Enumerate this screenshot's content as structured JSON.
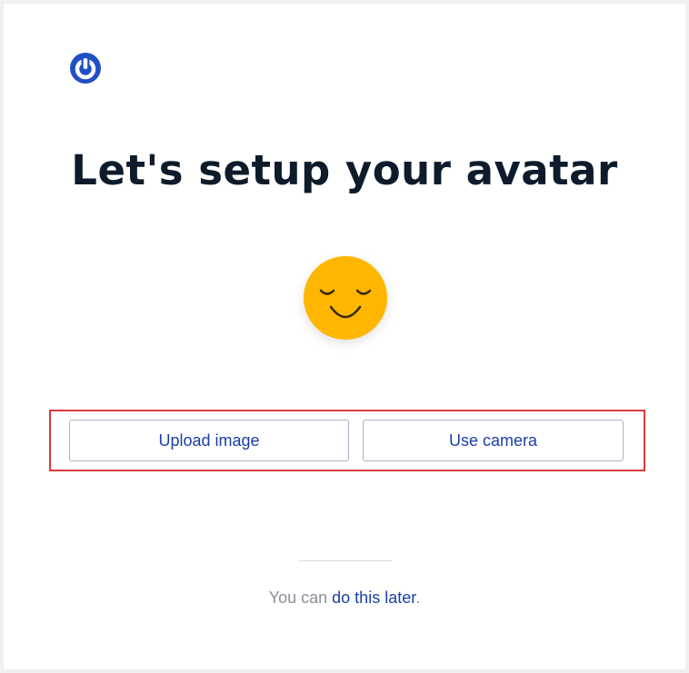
{
  "logo": {
    "icon": "power-icon",
    "color": "#1f4fc4"
  },
  "header": {
    "title": "Let's setup your avatar"
  },
  "avatar": {
    "icon": "smiling-face-icon",
    "color": "#ffb600"
  },
  "actions": {
    "upload_label": "Upload image",
    "camera_label": "Use camera"
  },
  "footer": {
    "prefix": "You can ",
    "link_label": "do this later",
    "suffix": "."
  }
}
